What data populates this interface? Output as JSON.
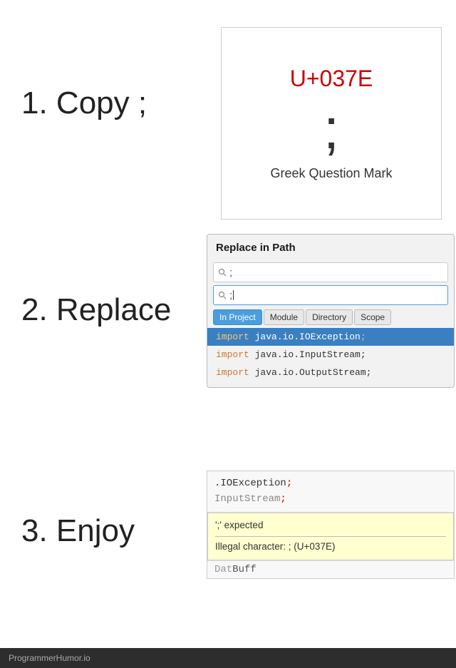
{
  "step1": {
    "label": "1. Copy ;",
    "unicode_code": "U+037E",
    "unicode_char": ";",
    "unicode_name": "Greek Question Mark"
  },
  "step2": {
    "label": "2. Replace",
    "dialog": {
      "title": "Replace in Path",
      "search_text": ";",
      "replace_text": ";",
      "tabs": [
        "In Project",
        "Module",
        "Directory",
        "Scope"
      ],
      "active_tab": "In Project",
      "results": [
        {
          "text": "import java.io.IOException;",
          "selected": true
        },
        {
          "text": "import java.io.InputStream;",
          "selected": false
        },
        {
          "text": "import java.io.OutputStream;",
          "selected": false
        }
      ]
    }
  },
  "step3": {
    "label": "3.  Enjoy",
    "code_lines": [
      ".IOException;",
      "InputStream"
    ],
    "errors": [
      "';' expected",
      "Illegal character: ; (U+037E)"
    ]
  },
  "footer": {
    "text": "ProgrammerHumor.io"
  }
}
